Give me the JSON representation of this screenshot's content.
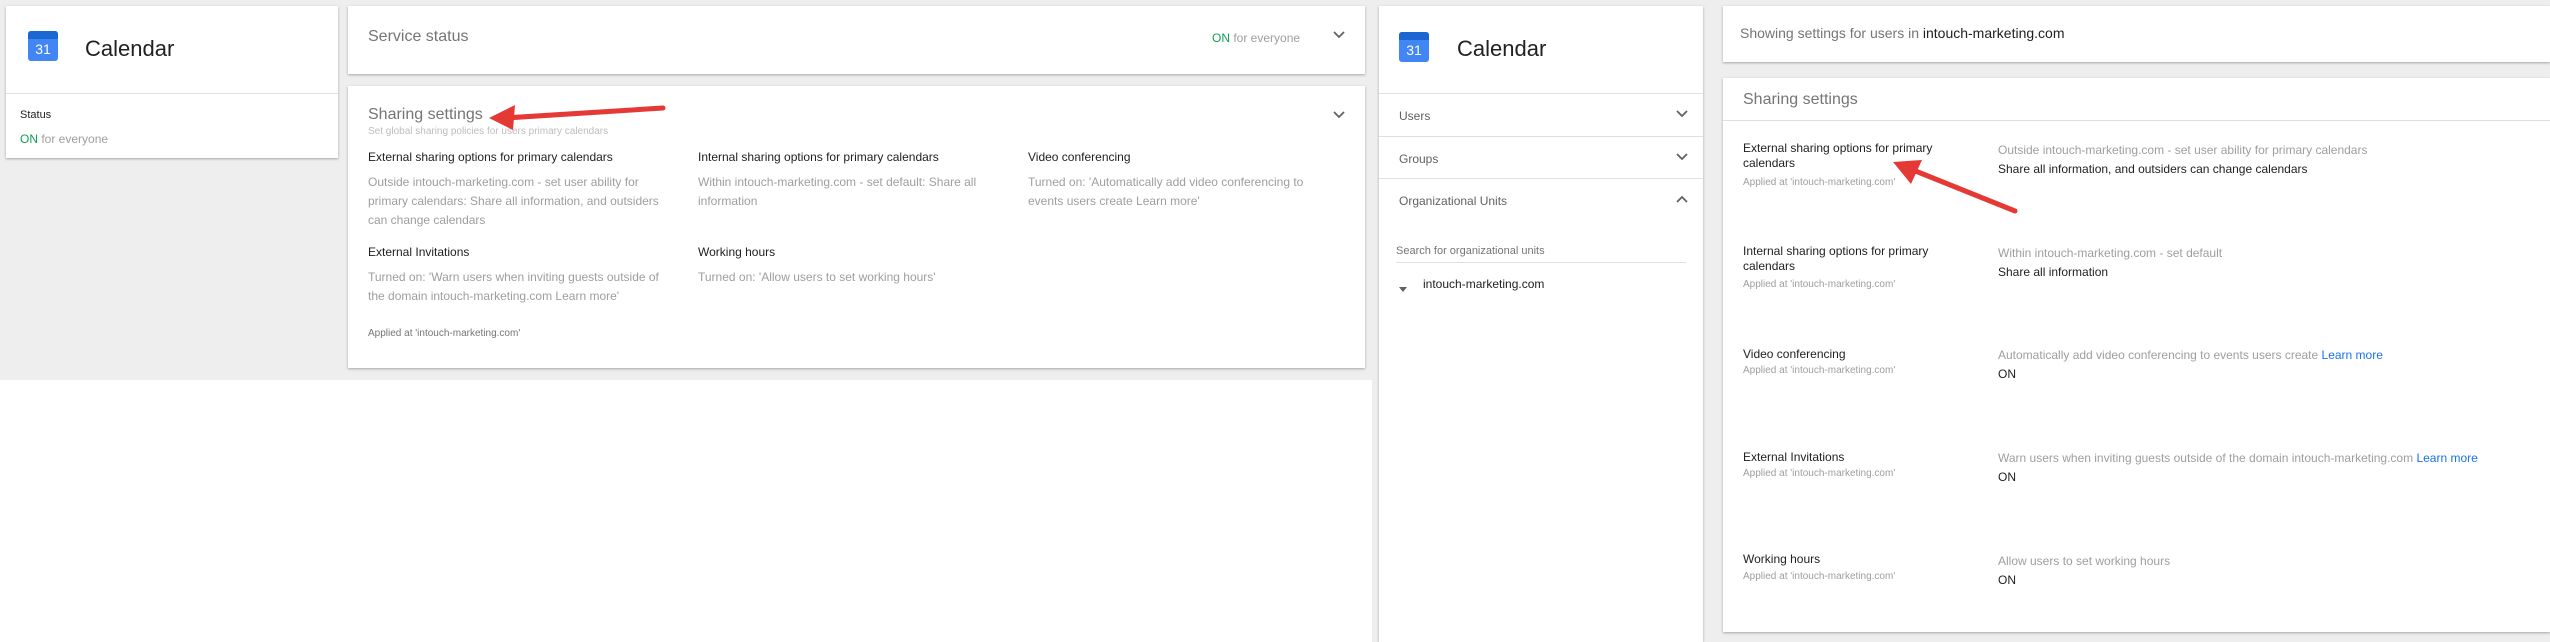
{
  "colors": {
    "accent": "#1a73e8",
    "on": "#0f9d58",
    "arrow": "#e53935",
    "calendar_blue": "#4285f4"
  },
  "left_app": {
    "icon": "calendar-icon",
    "icon_number": "31",
    "title": "Calendar",
    "status_label": "Status",
    "status_on": "ON",
    "status_rest": " for everyone"
  },
  "service_status": {
    "title": "Service status",
    "on": "ON",
    "rest": " for everyone"
  },
  "sharing_card": {
    "title": "Sharing settings",
    "subtitle": "Set global sharing policies for users primary calendars",
    "items": [
      {
        "label": "External sharing options for primary calendars",
        "desc": "Outside intouch-marketing.com - set user ability for primary calendars: Share all information, and outsiders can change calendars"
      },
      {
        "label": "Internal sharing options for primary calendars",
        "desc": "Within intouch-marketing.com - set default: Share all information"
      },
      {
        "label": "Video conferencing",
        "desc": "Turned on: 'Automatically add video conferencing to events users create Learn more'"
      },
      {
        "label": "External Invitations",
        "desc": "Turned on: 'Warn users when inviting guests outside of the domain intouch-marketing.com Learn more'"
      },
      {
        "label": "Working hours",
        "desc": "Turned on: 'Allow users to set working hours'"
      }
    ],
    "applied": "Applied at 'intouch-marketing.com'"
  },
  "right_app": {
    "icon_number": "31",
    "title": "Calendar",
    "nav": [
      "Users",
      "Groups",
      "Organizational Units"
    ],
    "search_placeholder": "Search for organizational units",
    "org_unit": "intouch-marketing.com"
  },
  "showing": {
    "prefix": "Showing settings for users in ",
    "domain": "intouch-marketing.com"
  },
  "detail": {
    "title": "Sharing settings",
    "rows": [
      {
        "label": "External sharing options for primary calendars",
        "applied": "Applied at 'intouch-marketing.com'",
        "desc": "Outside intouch-marketing.com - set user ability for primary calendars",
        "value": "Share all information, and outsiders can change calendars",
        "link": ""
      },
      {
        "label": "Internal sharing options for primary calendars",
        "applied": "Applied at 'intouch-marketing.com'",
        "desc": "Within intouch-marketing.com - set default",
        "value": "Share all information",
        "link": ""
      },
      {
        "label": "Video conferencing",
        "applied": "Applied at 'intouch-marketing.com'",
        "desc": "Automatically add video conferencing to events users create ",
        "value": "ON",
        "link": "Learn more"
      },
      {
        "label": "External Invitations",
        "applied": "Applied at 'intouch-marketing.com'",
        "desc": "Warn users when inviting guests outside of the domain intouch-marketing.com ",
        "value": "ON",
        "link": "Learn more"
      },
      {
        "label": "Working hours",
        "applied": "Applied at 'intouch-marketing.com'",
        "desc": "Allow users to set working hours",
        "value": "ON",
        "link": ""
      }
    ]
  }
}
